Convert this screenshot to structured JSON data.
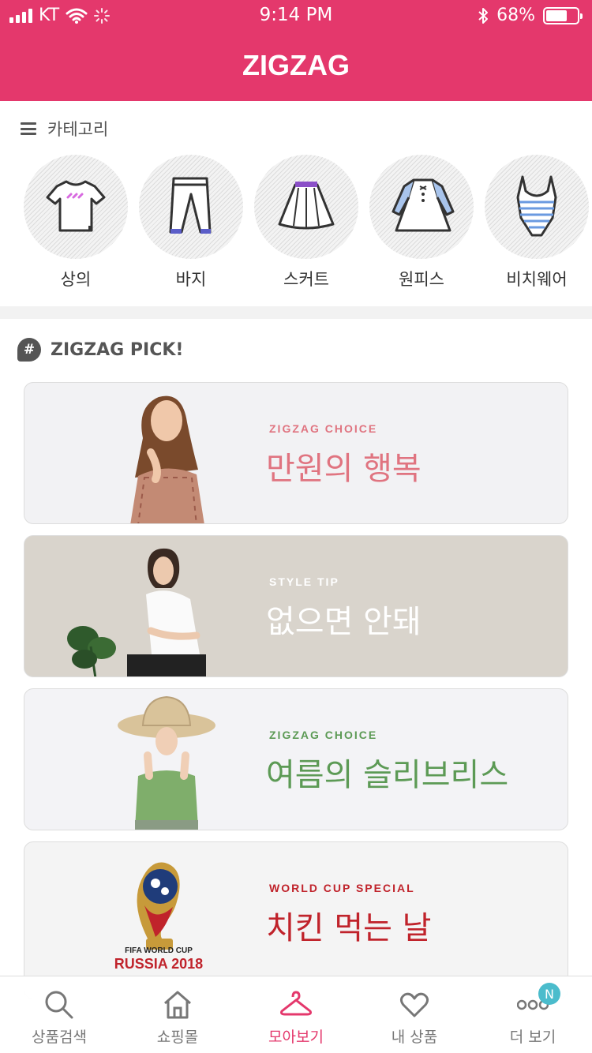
{
  "status": {
    "carrier": "KT",
    "time": "9:14 PM",
    "battery": "68%"
  },
  "header": {
    "logo": "ZIGZAG"
  },
  "categories": {
    "heading": "카테고리",
    "items": [
      {
        "label": "상의",
        "icon": "tshirt-icon"
      },
      {
        "label": "바지",
        "icon": "pants-icon"
      },
      {
        "label": "스커트",
        "icon": "skirt-icon"
      },
      {
        "label": "원피스",
        "icon": "dress-icon"
      },
      {
        "label": "비치웨어",
        "icon": "swimsuit-icon"
      }
    ]
  },
  "pick": {
    "heading": "ZIGZAG PICK!",
    "banners": [
      {
        "subtitle": "ZIGZAG CHOICE",
        "title": "만원의 행복",
        "bg": "#f2f2f4",
        "sub_color": "#e07480",
        "title_color": "#e07480"
      },
      {
        "subtitle": "STYLE TIP",
        "title": "없으면 안돼",
        "bg": "#d9d4cc",
        "sub_color": "#ffffff",
        "title_color": "#ffffff"
      },
      {
        "subtitle": "ZIGZAG CHOICE",
        "title": "여름의 슬리브리스",
        "bg": "#f3f3f6",
        "sub_color": "#5c9a55",
        "title_color": "#5c9a55"
      },
      {
        "subtitle": "WORLD CUP SPECIAL",
        "title": "치킨 먹는 날",
        "bg": "#f4f4f4",
        "sub_color": "#c0232b",
        "title_color": "#c0232b",
        "logo_line1": "FIFA WORLD CUP",
        "logo_line2": "RUSSIA 2018"
      }
    ]
  },
  "tabs": [
    {
      "label": "상품검색",
      "icon": "search-icon"
    },
    {
      "label": "쇼핑몰",
      "icon": "home-icon"
    },
    {
      "label": "모아보기",
      "icon": "hanger-icon",
      "active": true
    },
    {
      "label": "내 상품",
      "icon": "heart-icon"
    },
    {
      "label": "더 보기",
      "icon": "more-icon",
      "badge": "N"
    }
  ],
  "colors": {
    "brand": "#e4386c",
    "badge": "#4bbccc"
  }
}
